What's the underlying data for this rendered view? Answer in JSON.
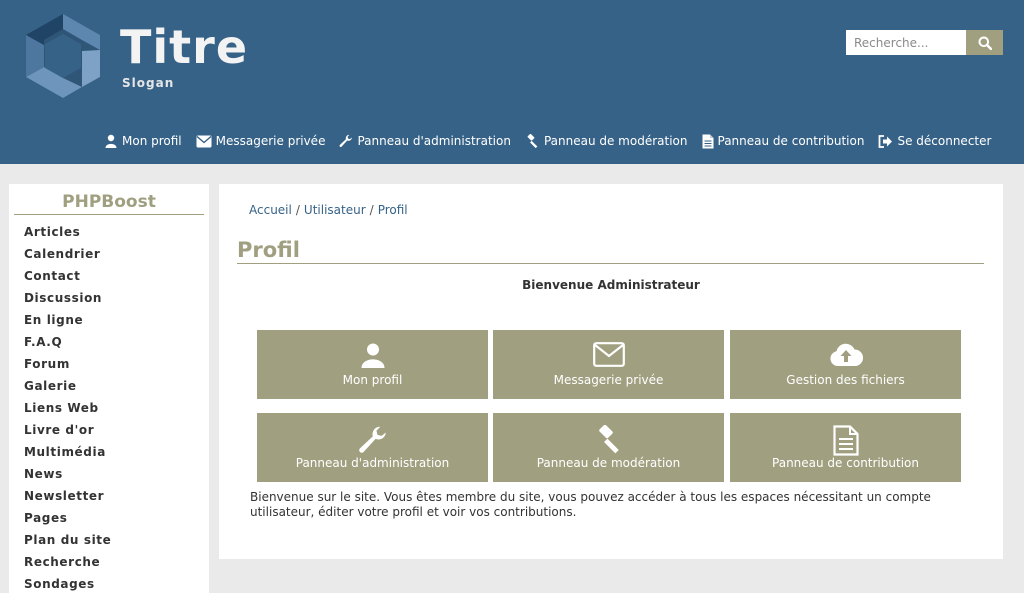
{
  "header": {
    "title": "Titre",
    "slogan": "Slogan",
    "search": {
      "placeholder": "Recherche...",
      "button_icon": "search-icon"
    },
    "colors": {
      "header_bg": "#366287",
      "accent": "#a09f80"
    }
  },
  "top_nav": [
    {
      "label": "Mon profil",
      "icon": "user-icon"
    },
    {
      "label": "Messagerie privée",
      "icon": "envelope-icon"
    },
    {
      "label": "Panneau d'administration",
      "icon": "wrench-icon"
    },
    {
      "label": "Panneau de modération",
      "icon": "gavel-icon"
    },
    {
      "label": "Panneau de contribution",
      "icon": "file-icon"
    },
    {
      "label": "Se déconnecter",
      "icon": "sign-out-icon"
    }
  ],
  "sidebar": {
    "title": "PHPBoost",
    "items": [
      "Articles",
      "Calendrier",
      "Contact",
      "Discussion",
      "En ligne",
      "F.A.Q",
      "Forum",
      "Galerie",
      "Liens Web",
      "Livre d'or",
      "Multimédia",
      "News",
      "Newsletter",
      "Pages",
      "Plan du site",
      "Recherche",
      "Sondages"
    ]
  },
  "breadcrumb": [
    "Accueil",
    "Utilisateur",
    "Profil"
  ],
  "main": {
    "title": "Profil",
    "welcome": "Bienvenue Administrateur",
    "tiles": [
      {
        "label": "Mon profil",
        "icon": "user-icon"
      },
      {
        "label": "Messagerie privée",
        "icon": "envelope-icon"
      },
      {
        "label": "Gestion des fichiers",
        "icon": "cloud-upload-icon"
      },
      {
        "label": "Panneau d'administration",
        "icon": "wrench-icon"
      },
      {
        "label": "Panneau de modération",
        "icon": "gavel-icon"
      },
      {
        "label": "Panneau de contribution",
        "icon": "file-icon"
      }
    ],
    "description": "Bienvenue sur le site. Vous êtes membre du site, vous pouvez accéder à tous les espaces nécessitant un compte utilisateur, éditer votre profil et voir vos contributions."
  }
}
